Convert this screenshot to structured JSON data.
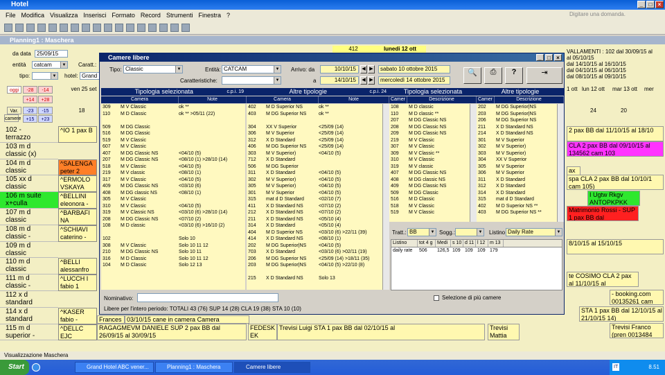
{
  "app": {
    "title": "Hotel",
    "help_placeholder": "Digitare una domanda."
  },
  "menu": [
    "File",
    "Modifica",
    "Visualizza",
    "Inserisci",
    "Formato",
    "Record",
    "Strumenti",
    "Finestra",
    "?"
  ],
  "planning": {
    "title": "Planning1 : Maschera",
    "dal": "da data",
    "dal_value": "25/09/15",
    "entita": "entità",
    "entita_value": "catcam",
    "caratt": "Caratt.:",
    "tipo": "tipo:",
    "hotel": "hotel:",
    "hotel_value": "Grand H",
    "nav": [
      "oggi",
      "-28",
      "-14",
      "+14",
      "+28",
      "Var.",
      "-23",
      "-15",
      "camere",
      "+15",
      "+23"
    ],
    "day_label": "ven 25 set",
    "day_num": "18",
    "rooms": [
      {
        "n": "102 -",
        "t": "terrazzo"
      },
      {
        "n": "103 m d",
        "t": "classic (x)"
      },
      {
        "n": "104 m d",
        "t": "classic"
      },
      {
        "n": "105 xx d",
        "t": "classic"
      },
      {
        "n": "106 m suite",
        "t": "x+culla"
      },
      {
        "n": "107 m d",
        "t": "classic"
      },
      {
        "n": "108 m d",
        "t": "classic -"
      },
      {
        "n": "109 m d",
        "t": "classic"
      },
      {
        "n": "110 m d",
        "t": "classic"
      },
      {
        "n": "111 m d",
        "t": "classic -"
      },
      {
        "n": "112 x d",
        "t": "standard"
      },
      {
        "n": "114 x d",
        "t": "standard"
      },
      {
        "n": "115 m d",
        "t": "superior -"
      }
    ],
    "bookings": [
      {
        "t": "^IO 1 pax B"
      },
      {
        "t": "^SALENGA peter 2"
      },
      {
        "t": "^ERMOLO VSKAYA"
      },
      {
        "t": "^BELLINI eleonora -"
      },
      {
        "t": "^BARBAFI NA"
      },
      {
        "t": "^SCHIAVI caterino -"
      },
      {
        "t": "^BELLI alessanfro"
      },
      {
        "t": "^LUCCH I fabio 1"
      },
      {
        "t": "^KASER fabio -"
      },
      {
        "t": "^DELLC EJC"
      }
    ],
    "right_header": [
      "412",
      "lunedi 12 ott"
    ],
    "right_days": [
      "1 ott",
      "lun 12 ott",
      "mar 13 ott",
      "mer"
    ],
    "right_nums": [
      "24",
      "20"
    ],
    "right_notes": [
      "VALLAMENTI : 102 dal 30/09/15 al",
      "al 05/10/15",
      "dal 14/10/15 al 16/10/15",
      "dal 04/10/15 al 06/10/15",
      "dal 08/10/15 al 09/10/15"
    ],
    "right_bookings": [
      {
        "t": "2 pax BB dal 11/10/15 al 18/10"
      },
      {
        "t": "CLA 2 pax BB dal 09/10/15 al 134562 cam 103"
      },
      {
        "t": "ax"
      },
      {
        "t": "spa CLA 2 pax BB dal 10/10/1 cam 105)"
      },
      {
        "t": "I Ugtw Rkgv ANTOPKPKK"
      },
      {
        "t": "Matrimonio Rossi - SUP 1 pax BB dal"
      },
      {
        "t": "8/10/15 al 15/10/15"
      },
      {
        "t": "te COSIMO CLA 2 pax al 11/10/15 al"
      },
      {
        "t": "- booking.com 00135261 cam"
      },
      {
        "t": "STA 1 pax BB dal 12/10/15 al 21/10/15 14)"
      },
      {
        "t": "Trevisi Franco (pren 0013484"
      }
    ],
    "bottom_row": [
      "Frances",
      "03/10/15 cane in camera Camera",
      "RAGAGMEVM DANIELE SUP 2 pax BB dal 26/09/15 al 30/09/15",
      "FEDESK EK",
      "Trevisi Luigi STA 1 pax BB dal 02/10/15 al",
      "Trevisi Mattia"
    ]
  },
  "dialog": {
    "title": "Camere libere",
    "tipo_label": "Tipo:",
    "tipo_value": "Classic",
    "entita_label": "Entità:",
    "entita_value": "CATCAM",
    "caratt_label": "Caratteristiche:",
    "arrivo_label": "Arrivo: da",
    "arrivo_value": "10/10/15",
    "arrivo_text": "sabato 10 ottobre 2015",
    "a_label": "a",
    "a_value": "14/10/15",
    "a_text": "mercoledì 14 ottobre 2015",
    "sections": {
      "left1": "Tipologia selezionata",
      "cpi1": "c.p.i. 19",
      "left2": "Altre tipologie",
      "cpi2": "c.p.i. 24",
      "right1": "Tipologia selezionata",
      "right2": "Altre tipologie"
    },
    "cols": {
      "camera": "Camera",
      "note": "Note",
      "cam": "Camer",
      "descr": "Descrizione"
    },
    "sel_rows": [
      [
        "309",
        "M V Classic",
        "ok **"
      ],
      [
        "110",
        "M D Classic",
        "ok ** >05/11 (22)"
      ],
      [
        "",
        "",
        " "
      ],
      [
        "509",
        "M DG Classic",
        ""
      ],
      [
        "516",
        "M DG Classic",
        ""
      ],
      [
        "519",
        "M V Classic",
        ""
      ],
      [
        "607",
        "M V Classic",
        ""
      ],
      [
        "407",
        "M DG Classic NS",
        "<04/10 (5)"
      ],
      [
        "207",
        "M DG Classic NS",
        "<08/10 (1) >28/10 (14)"
      ],
      [
        "518",
        "M V Classic",
        "<04/10 (5)"
      ],
      [
        "219",
        "M V classic",
        "<08/10 (1)"
      ],
      [
        "317",
        "M V Classic",
        "<04/10 (5)"
      ],
      [
        "409",
        "M DG Classic NS",
        "<03/10 (6)"
      ],
      [
        "408",
        "M DG classic NS",
        "<08/10 (1)"
      ],
      [
        "305",
        "M V Classic",
        ""
      ],
      [
        "310",
        "M V Classic",
        "<04/10 (5)"
      ],
      [
        "319",
        "M V Classic NS",
        "<03/10 (6) >28/10 (14)"
      ],
      [
        "208",
        "M DG Classic NS",
        "<07/10 (2)"
      ],
      [
        "108",
        "M D classic",
        "<03/10 (6) >16/10 (2)"
      ],
      [
        "",
        "",
        ""
      ],
      [
        "102",
        "",
        "Solo 10"
      ],
      [
        "308",
        "M V Classic",
        "Solo 10 11 12"
      ],
      [
        "210",
        "M DG Classic NS",
        "Solo 10 11"
      ],
      [
        "316",
        "M D Classic",
        "Solo 10 11 12"
      ],
      [
        "104",
        "M D Classic",
        "Solo 12 13"
      ]
    ],
    "other_rows": [
      [
        "402",
        "M D Superior NS",
        "ok **"
      ],
      [
        "403",
        "M DG Superior NS",
        "ok **"
      ],
      [
        "",
        "",
        " "
      ],
      [
        "304",
        "XX V Superior",
        "<25/09 (14)"
      ],
      [
        "306",
        "M V Superior",
        "<25/09 (14)"
      ],
      [
        "312",
        "X D Standard",
        "<25/09 (14)"
      ],
      [
        "406",
        "M DG Superior NS",
        "<25/09 (14)"
      ],
      [
        "303",
        "M V Superior)",
        "<04/10 (5)"
      ],
      [
        "712",
        "X D Standard",
        ""
      ],
      [
        "506",
        "M DG Superior",
        ""
      ],
      [
        "311",
        "X D Standard",
        "<04/10 (5)"
      ],
      [
        "302",
        "M V Superior)",
        "<04/10 (5)"
      ],
      [
        "305",
        "M V Superior)",
        "<04/10 (5)"
      ],
      [
        "301",
        "M V Superior",
        "<04/10 (5)"
      ],
      [
        "315",
        "mat d D Standard",
        "<02/10 (7)"
      ],
      [
        "411",
        "X D Standard NS",
        "<07/10 (2)"
      ],
      [
        "212",
        "X D Standard NS",
        "<07/10 (2)"
      ],
      [
        "211",
        "X D Standard NS",
        "<05/10 (4)"
      ],
      [
        "314",
        "X D Standard",
        "<05/10 (4)"
      ],
      [
        "404",
        "M D Superior NS",
        "<03/10 (6) >22/11 (39)"
      ],
      [
        "414",
        "X D Standard NS",
        "<08/10 (1)"
      ],
      [
        "202",
        "M DG Superior|NS",
        "<04/10 (5)"
      ],
      [
        "703",
        "X D Standard",
        "<03/10 (6) >02/11 (19)"
      ],
      [
        "206",
        "M DG Superior NS",
        "<25/09 (14) >18/11 (35)"
      ],
      [
        "203",
        "M DG Superior|NS",
        "<04/10 (5) >22/10 (8)"
      ],
      [
        "",
        "",
        ""
      ],
      [
        "215",
        "X D Standard NS",
        "Solo 13"
      ]
    ],
    "right_sel": [
      [
        "108",
        "M D classic"
      ],
      [
        "110",
        "M D classic **"
      ],
      [
        "207",
        "M DG Classic NS"
      ],
      [
        "208",
        "M DG Classic NS"
      ],
      [
        "209",
        "M DG Classic NS"
      ],
      [
        "219",
        "M V Classic"
      ],
      [
        "307",
        "M V Classic"
      ],
      [
        "309",
        "M V Classic **"
      ],
      [
        "310",
        "M V Classic"
      ],
      [
        "319",
        "M V classic"
      ],
      [
        "407",
        "M DG Classic NS"
      ],
      [
        "408",
        "M DG classic NS"
      ],
      [
        "409",
        "M DG Classic NS"
      ],
      [
        "509",
        "M DG Classic"
      ],
      [
        "516",
        "M D Classic"
      ],
      [
        "518",
        "M V Classic"
      ],
      [
        "519",
        "M V Classic"
      ]
    ],
    "right_other": [
      [
        "202",
        "M DG Superior|NS"
      ],
      [
        "203",
        "M DG Superior|NS"
      ],
      [
        "206",
        "M DG Superior NS"
      ],
      [
        "211",
        "X D Standard NS"
      ],
      [
        "214",
        "X D Standard NS"
      ],
      [
        "301",
        "M V Superior"
      ],
      [
        "302",
        "M V Superior)"
      ],
      [
        "303",
        "M V Superior)"
      ],
      [
        "304",
        "XX V Superior"
      ],
      [
        "305",
        "M V Superior"
      ],
      [
        "306",
        "M V Superior"
      ],
      [
        "311",
        "X D Standard"
      ],
      [
        "312",
        "X D Standard"
      ],
      [
        "314",
        "X D Standard"
      ],
      [
        "315",
        "mat d D Standard"
      ],
      [
        "402",
        "M D Superior NS **"
      ],
      [
        "403",
        "M DG Superior NS **"
      ]
    ],
    "tratt_label": "Tratt.:",
    "tratt_value": "BB",
    "sogg_label": "Sogg.:",
    "listino_label": "Listino",
    "listino_value": "Daily Rate",
    "rate_cols": [
      "Listino",
      "tot 4 g",
      "Medi",
      "s 10",
      "d 11",
      "l 12",
      "m 13"
    ],
    "rate_row": [
      "daily rate",
      "506",
      "126,5",
      "109",
      "109",
      "109",
      "179"
    ],
    "nominativo_label": "Nominativo:",
    "multi_label": "Selezione di più camere",
    "totals": "Libere per l'intero periodo:  TOTALI 43 (76)   SUP 14 (28)   CLA 19 (38)   STA 10 (10)"
  },
  "status": "Visualizzazione Maschera",
  "taskbar": {
    "start": "Start",
    "tasks": [
      "Grand Hotel ABC  vener...",
      "Planning1 : Maschera",
      "Camere libere"
    ],
    "lang": "IT",
    "clock": "8.51"
  }
}
